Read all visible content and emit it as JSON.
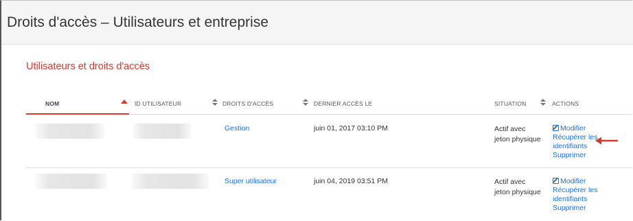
{
  "page": {
    "title": "Droits d'accès – Utilisateurs et entreprise"
  },
  "section": {
    "title": "Utilisateurs et droits d'accès"
  },
  "table": {
    "columns": [
      "NOM",
      "ID UTILISATEUR",
      "DROITS D'ACCÈS",
      "DERNIER ACCÈS LE",
      "SITUATION",
      "ACTIONS"
    ],
    "sorted_column": "NOM",
    "sort_direction": "ascending",
    "rows": [
      {
        "nom": "",
        "id_utilisateur": "",
        "droits": "Gestion",
        "dernier_acces": "juin 01, 2017 03:10 PM",
        "situation": "Actif avec jeton physique",
        "actions": {
          "modify": "Modifier",
          "recover": "Récupérer les identifiants",
          "delete": "Supprimer"
        }
      },
      {
        "nom": "",
        "id_utilisateur": "",
        "droits": "Super utilisateur",
        "dernier_acces": "juin 04, 2019 03:51 PM",
        "situation": "Actif avec jeton physique",
        "actions": {
          "modify": "Modifier",
          "recover": "Récupérer les identifiants",
          "delete": "Supprimer"
        }
      }
    ]
  },
  "colors": {
    "accent": "#d9372b",
    "link": "#1a73e8",
    "header_bg": "#f5f5f5"
  },
  "annotations": {
    "arrow_color": "#d9372b",
    "arrow_icon": "red-arrow-left-icon"
  }
}
